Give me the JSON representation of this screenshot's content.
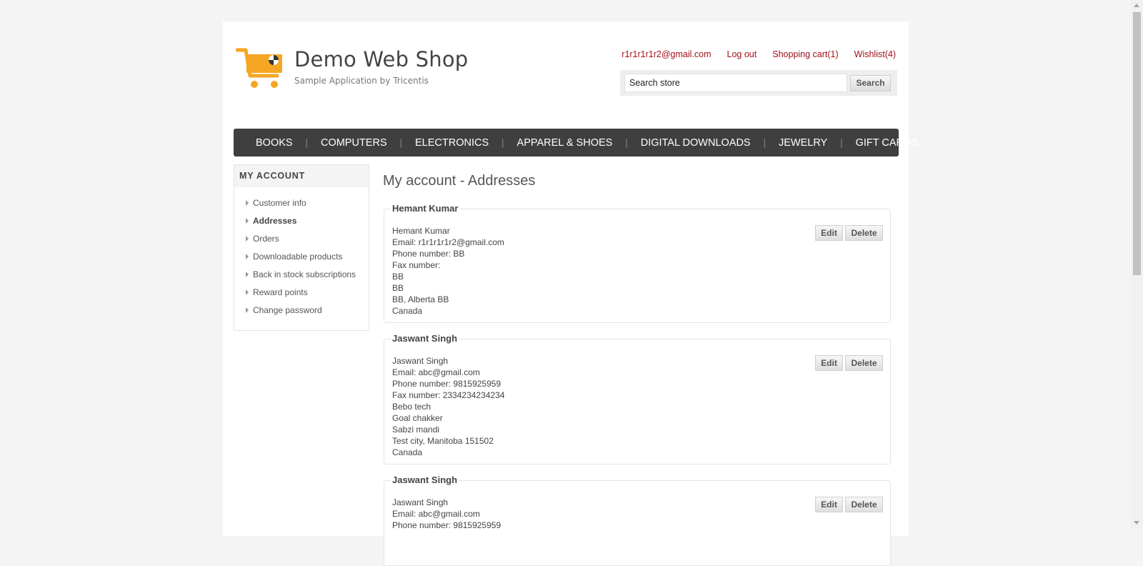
{
  "brand": {
    "title": "Demo Web Shop",
    "subtitle": "Sample Application by Tricentis",
    "accent": "#f5a623"
  },
  "header": {
    "account_email": "r1r1r1r1r2@gmail.com",
    "logout": "Log out",
    "cart": "Shopping cart",
    "cart_count": "(1)",
    "wishlist": "Wishlist",
    "wishlist_count": "(4)",
    "link_color": "#a21018"
  },
  "search": {
    "value": "Search store",
    "button": "Search"
  },
  "nav": {
    "items": [
      "BOOKS",
      "COMPUTERS",
      "ELECTRONICS",
      "APPAREL & SHOES",
      "DIGITAL DOWNLOADS",
      "JEWELRY",
      "GIFT CARDS"
    ]
  },
  "sidebar": {
    "heading": "MY ACCOUNT",
    "items": [
      {
        "label": "Customer info"
      },
      {
        "label": "Addresses",
        "active": true
      },
      {
        "label": "Orders"
      },
      {
        "label": "Downloadable products"
      },
      {
        "label": "Back in stock subscriptions"
      },
      {
        "label": "Reward points"
      },
      {
        "label": "Change password"
      }
    ]
  },
  "main": {
    "title": "My account - Addresses",
    "edit_label": "Edit",
    "delete_label": "Delete",
    "addresses": [
      {
        "name": "Hemant Kumar",
        "lines": [
          "Hemant Kumar",
          "Email: r1r1r1r1r2@gmail.com",
          "Phone number: BB",
          "Fax number:",
          "BB",
          "BB",
          "BB, Alberta BB",
          "Canada"
        ]
      },
      {
        "name": "Jaswant Singh",
        "lines": [
          "Jaswant Singh",
          "Email: abc@gmail.com",
          "Phone number: 9815925959",
          "Fax number: 2334234234234",
          "Bebo tech",
          "Goal chakker",
          "Sabzi mandi",
          "Test city, Manitoba 151502",
          "Canada"
        ]
      },
      {
        "name": "Jaswant Singh",
        "lines": [
          "Jaswant Singh",
          "Email: abc@gmail.com",
          "Phone number: 9815925959"
        ]
      }
    ]
  }
}
